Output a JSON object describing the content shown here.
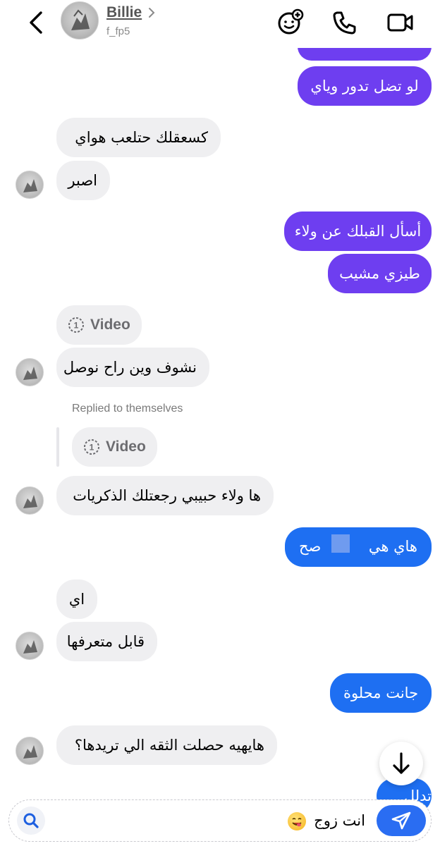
{
  "header": {
    "name": "Billie",
    "username": "f_fp5",
    "icons": [
      "back-chevron-icon",
      "contact-avatar",
      "chevron-right-icon",
      "effects-icon",
      "phone-icon",
      "video-camera-icon"
    ]
  },
  "messages": {
    "m0": "لو تضل تدور وياي",
    "m1": "كسعقلك حتلعب هواي",
    "m2": "اصبر",
    "m3": "أسأل القبلك عن ولاء",
    "m4": "طيزي مشيب",
    "m5_label": "Video",
    "m5_count": "1",
    "m6": "نشوف وين راح نوصل",
    "replied_label": "Replied to themselves",
    "m7_label": "Video",
    "m7_count": "1",
    "m8": "ها ولاء حبيبي رجعتلك الذكريات",
    "m9_a": "هاي هي",
    "m9_b": "صح",
    "m10": "اي",
    "m11": "قابل متعرفها",
    "m12": "جانت محلوة",
    "m13": "هايهيه حصلت الثقه الي تريدها؟",
    "m14_partial": "تدلل"
  },
  "composer": {
    "text": "انت زوج",
    "emoji": "😋"
  },
  "colors": {
    "purple": "#6e3ef0",
    "blue": "#1e6ff2",
    "incoming": "#efeff1"
  }
}
